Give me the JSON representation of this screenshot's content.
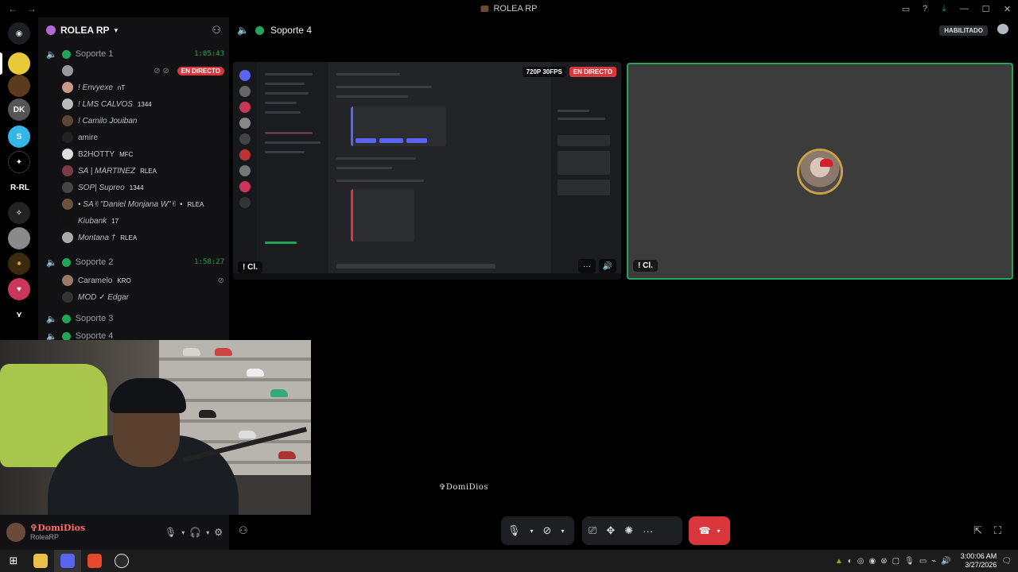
{
  "window": {
    "title": "ROLEA RP",
    "back_glyph": "←",
    "forward_glyph": "→",
    "minimize_glyph": "—",
    "maximize_glyph": "☐",
    "close_glyph": "✕"
  },
  "server": {
    "name": "ROLEA RP",
    "rail_labels": {
      "dk": "DK",
      "rrl": "R-RL"
    }
  },
  "channels": [
    {
      "name": "Soporte 1",
      "timer": "1:05:43",
      "users": [
        {
          "name": "",
          "badge": "",
          "live": "EN DIRECTO"
        },
        {
          "name": "! Envyexe",
          "badge": "nT"
        },
        {
          "name": "! LMS CALVOS",
          "badge": "1344"
        },
        {
          "name": "! Camilo Jouiban",
          "badge": ""
        },
        {
          "name": "amire",
          "badge": ""
        },
        {
          "name": "B2HOTTY",
          "badge": "MFC"
        },
        {
          "name": "SA | MARTINEZ",
          "badge": "RLEA"
        },
        {
          "name": "SOP| Supreo",
          "badge": "1344"
        },
        {
          "name": "• SA✌\"Daniel Monjana W\"✌ •",
          "badge": "RLEA"
        },
        {
          "name": "Kiubank",
          "badge": "17"
        },
        {
          "name": "Montana †",
          "badge": "RLEA"
        }
      ]
    },
    {
      "name": "Soporte 2",
      "timer": "1:58:27",
      "users": [
        {
          "name": "Caramelo",
          "badge": "KRO"
        },
        {
          "name": "MOD ✓ Edgar",
          "badge": ""
        }
      ]
    },
    {
      "name": "Soporte 3",
      "timer": "",
      "users": []
    },
    {
      "name": "Soporte 4",
      "timer": "",
      "users": []
    }
  ],
  "main": {
    "channel": "Soporte 4",
    "enabled_badge": "HABILITADO",
    "stream": {
      "quality": "720P 30FPS",
      "live": "EN DIRECTO",
      "label": "! Cl.",
      "more": "···",
      "volume": "🔊"
    },
    "camera": {
      "label": "! Cl."
    },
    "watermark": "✞DomiDios"
  },
  "user_panel": {
    "name": "✞DomiDios",
    "status": "RoleaRP"
  },
  "taskbar": {
    "time": "3:00:06 AM",
    "date": "3/27/2026"
  },
  "colors": {
    "accent_green": "#23a559",
    "live_red": "#da373c",
    "blurple": "#5865f2"
  }
}
